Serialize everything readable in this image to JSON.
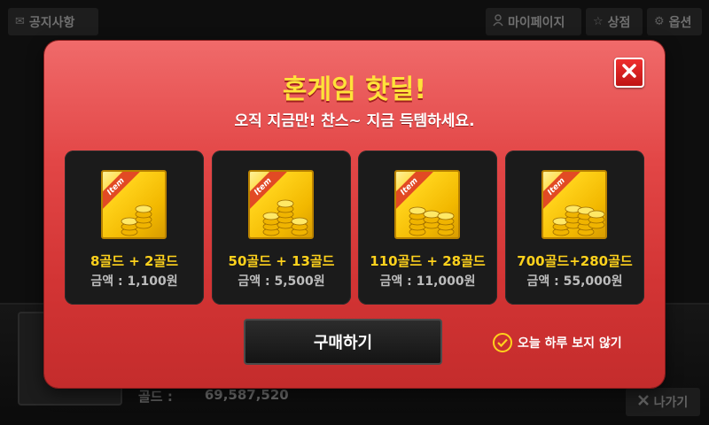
{
  "topbar": {
    "notice_label": "공지사항",
    "mypage_label": "마이페이지",
    "shop_label": "상점",
    "options_label": "옵션"
  },
  "background": {
    "gold_label": "골드 :",
    "gold_value": "69,587,520",
    "exit_label": "나가기"
  },
  "modal": {
    "title": "혼게임 핫딜!",
    "subtitle": "오직 지금만! 찬스~ 지금 득템하세요.",
    "ribbon_label": "Item",
    "products": [
      {
        "gold": "8골드 + 2골드",
        "price": "금액 : 1,100원",
        "coin_stacks": 2
      },
      {
        "gold": "50골드 + 13골드",
        "price": "금액 : 5,500원",
        "coin_stacks": 3
      },
      {
        "gold": "110골드 + 28골드",
        "price": "금액 : 11,000원",
        "coin_stacks": 3
      },
      {
        "gold": "700골드+280골드",
        "price": "금액 : 55,000원",
        "coin_stacks": 4
      }
    ],
    "buy_label": "구매하기",
    "no_show_label": "오늘 하루 보지 않기"
  },
  "colors": {
    "modal_top": "#f06a6a",
    "modal_bottom": "#c42c2c",
    "title": "#ffe23a",
    "gold_text": "#ffd21c",
    "price_text": "#bdbdbd",
    "close_button": "#d81e1e"
  },
  "icons": {
    "notice": "envelope-icon",
    "mypage": "person-icon",
    "shop": "star-icon",
    "options": "gear-icon",
    "close": "close-icon",
    "exit": "close-icon",
    "no_show": "check-circle-icon"
  }
}
